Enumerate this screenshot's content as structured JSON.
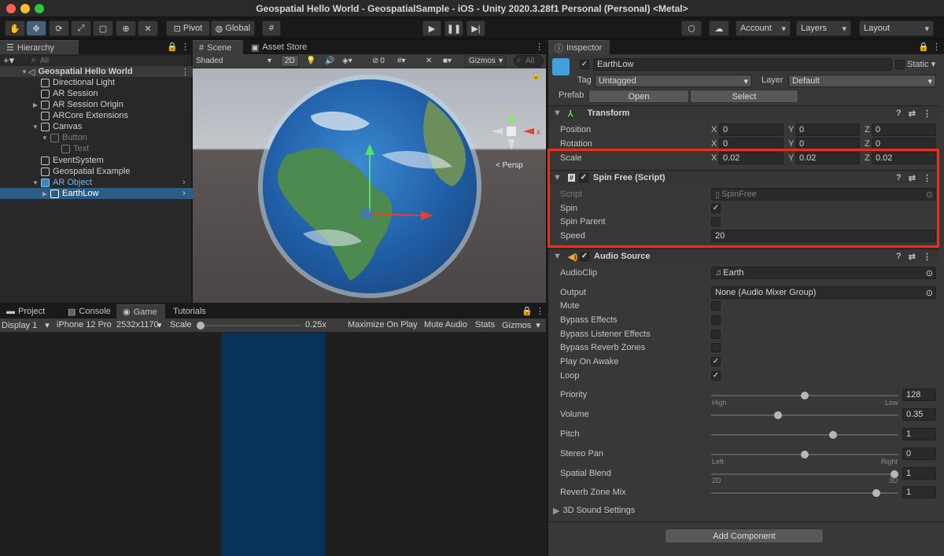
{
  "window": {
    "title": "Geospatial Hello World - GeospatialSample - iOS - Unity 2020.3.28f1 Personal (Personal) <Metal>",
    "traffic_colors": [
      "#fe5f57",
      "#febc2e",
      "#28c840"
    ]
  },
  "toolbar": {
    "pivot": "Pivot",
    "global": "Global",
    "account": "Account",
    "layers": "Layers",
    "layout": "Layout"
  },
  "hierarchy": {
    "tab": "Hierarchy",
    "search_placeholder": "All",
    "items": [
      {
        "label": "Geospatial Hello World"
      },
      {
        "label": "Directional Light"
      },
      {
        "label": "AR Session"
      },
      {
        "label": "AR Session Origin"
      },
      {
        "label": "ARCore Extensions"
      },
      {
        "label": "Canvas"
      },
      {
        "label": "Button"
      },
      {
        "label": "Text"
      },
      {
        "label": "EventSystem"
      },
      {
        "label": "Geospatial Example"
      },
      {
        "label": "AR Object"
      },
      {
        "label": "EarthLow"
      }
    ]
  },
  "scene": {
    "tab_scene": "Scene",
    "tab_asset_store": "Asset Store",
    "shading": "Shaded",
    "mode_2d": "2D",
    "hidden_count": "0",
    "gizmos": "Gizmos",
    "search_placeholder": "All",
    "persp": "< Persp",
    "axis_y": "y",
    "axis_x": "x"
  },
  "game": {
    "tabs": [
      "Project",
      "Console",
      "Game",
      "Tutorials"
    ],
    "display": "Display 1",
    "device": "iPhone 12 Pro",
    "resolution": "2532x1170",
    "scale_label": "Scale",
    "scale_value": "0.25x",
    "maximize": "Maximize On Play",
    "mute": "Mute Audio",
    "stats": "Stats",
    "gizmos": "Gizmos"
  },
  "inspector": {
    "tab": "Inspector",
    "object_name": "EarthLow",
    "static": "Static",
    "tag_label": "Tag",
    "tag": "Untagged",
    "layer_label": "Layer",
    "layer": "Default",
    "prefab_label": "Prefab",
    "open": "Open",
    "select": "Select",
    "transform": {
      "title": "Transform",
      "position": {
        "label": "Position",
        "x": "0",
        "y": "0",
        "z": "0"
      },
      "rotation": {
        "label": "Rotation",
        "x": "0",
        "y": "0",
        "z": "0"
      },
      "scale": {
        "label": "Scale",
        "x": "0.02",
        "y": "0.02",
        "z": "0.02"
      }
    },
    "spin": {
      "title": "Spin Free (Script)",
      "script_label": "Script",
      "script_value": "SpinFree",
      "spin_label": "Spin",
      "spin_parent_label": "Spin Parent",
      "speed_label": "Speed",
      "speed_value": "20"
    },
    "audio": {
      "title": "Audio Source",
      "clip_label": "AudioClip",
      "clip_value": "Earth",
      "output_label": "Output",
      "output_value": "None (Audio Mixer Group)",
      "mute": "Mute",
      "bypass_effects": "Bypass Effects",
      "bypass_listener": "Bypass Listener Effects",
      "bypass_reverb": "Bypass Reverb Zones",
      "play_on_awake": "Play On Awake",
      "loop": "Loop",
      "priority": {
        "label": "Priority",
        "value": "128",
        "min_label": "High",
        "max_label": "Low",
        "fraction": 0.5
      },
      "volume": {
        "label": "Volume",
        "value": "0.35",
        "fraction": 0.35
      },
      "pitch": {
        "label": "Pitch",
        "value": "1",
        "fraction": 0.657
      },
      "stereo_pan": {
        "label": "Stereo Pan",
        "value": "0",
        "min_label": "Left",
        "max_label": "Right",
        "fraction": 0.5
      },
      "spatial_blend": {
        "label": "Spatial Blend",
        "value": "1",
        "min_label": "2D",
        "max_label": "3D",
        "fraction": 1.0
      },
      "reverb_mix": {
        "label": "Reverb Zone Mix",
        "value": "1",
        "fraction": 0.9
      },
      "sound_settings": "3D Sound Settings"
    },
    "add_component": "Add Component"
  },
  "highlight_color": "#ff2a10"
}
